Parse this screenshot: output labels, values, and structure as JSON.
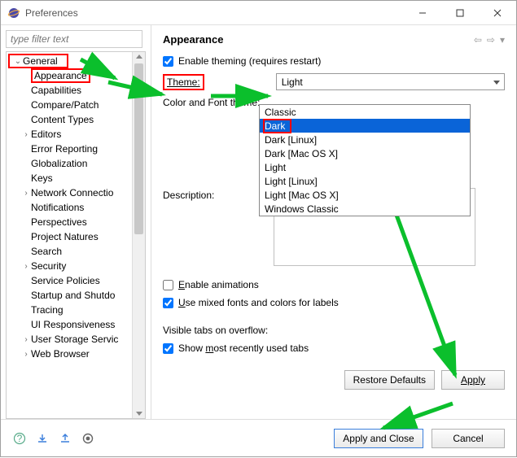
{
  "window": {
    "title": "Preferences"
  },
  "filter": {
    "placeholder": "type filter text"
  },
  "tree": {
    "general": "General",
    "items": [
      "Appearance",
      "Capabilities",
      "Compare/Patch",
      "Content Types",
      "Editors",
      "Error Reporting",
      "Globalization",
      "Keys",
      "Network Connectio",
      "Notifications",
      "Perspectives",
      "Project Natures",
      "Search",
      "Security",
      "Service Policies",
      "Startup and Shutdo",
      "Tracing",
      "UI Responsiveness",
      "User Storage Servic",
      "Web Browser"
    ]
  },
  "page": {
    "title": "Appearance",
    "enable_theming": "Enable theming (requires restart)",
    "theme_label": "Theme:",
    "theme_value": "Light",
    "color_font_label": "Color and Font theme:",
    "dropdown": [
      "Classic",
      "Dark",
      "Dark [Linux]",
      "Dark [Mac OS X]",
      "Light",
      "Light [Linux]",
      "Light [Mac OS X]",
      "Windows Classic"
    ],
    "description_label": "Description:",
    "enable_animations": "Enable animations",
    "mixed_fonts": "Use mixed fonts and colors for labels",
    "visible_tabs": "Visible tabs on overflow:",
    "show_mru": "Show most recently used tabs",
    "restore_defaults": "Restore Defaults",
    "apply": "Apply"
  },
  "bottom": {
    "apply_close": "Apply and Close",
    "cancel": "Cancel"
  }
}
